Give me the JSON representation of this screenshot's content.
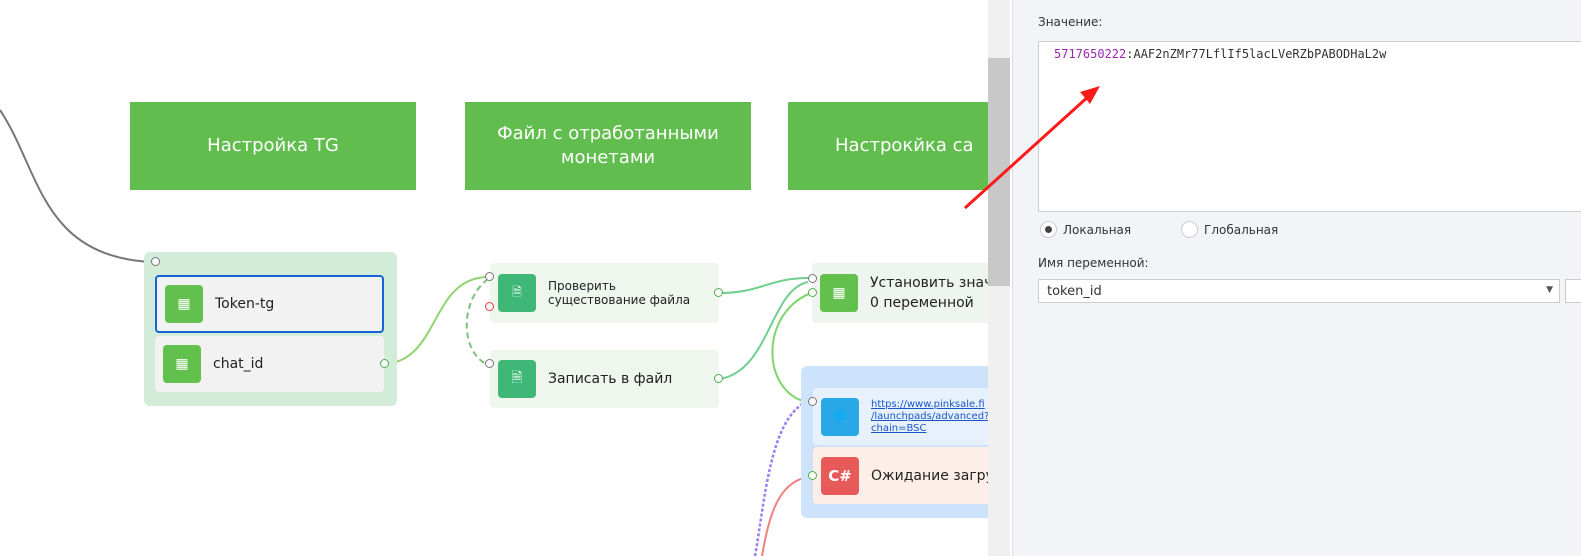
{
  "canvas": {
    "headers": [
      "Настройка TG",
      "Файл с отработанными монетами",
      "Настрокйка са"
    ],
    "group1": {
      "nodes": [
        {
          "label": "Token-tg",
          "icon": "grid-icon"
        },
        {
          "label": "chat_id",
          "icon": "grid-icon"
        }
      ]
    },
    "file_nodes": [
      {
        "label": "Проверить существование файла",
        "icon": "file-icon"
      },
      {
        "label": "Записать в файл",
        "icon": "file-icon"
      }
    ],
    "set_node": {
      "label_line1": "Установить знач",
      "label_line2": "0 переменной",
      "icon": "grid-icon"
    },
    "group2": {
      "url_node": {
        "line1": "https://www.pinksale.fi",
        "line2": "/launchpads/advanced?",
        "line3": "chain=BSC",
        "icon": "globe-icon"
      },
      "cs_node": {
        "label": "Ожидание загру:",
        "icon_text": "C#"
      }
    }
  },
  "panel": {
    "value_label": "Значение:",
    "value_number": "5717650222",
    "value_rest": ":AAF2nZMr77LflIf5lacLVeRZbPABODHaL2w",
    "radio_local": "Локальная",
    "radio_global": "Глобальная",
    "selected_scope": "local",
    "var_name_label": "Имя переменной:",
    "var_name_value": "token_id"
  },
  "colors": {
    "header_green": "#62bd4f",
    "number_purple": "#9c27b0",
    "arrow_red": "#ff1a1a",
    "csharp_red": "#e85a5a",
    "globe_blue": "#29a8e8"
  }
}
